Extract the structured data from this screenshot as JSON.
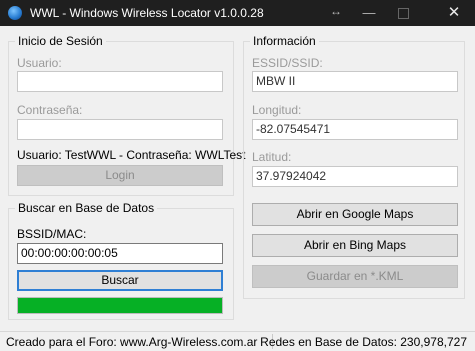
{
  "window": {
    "title": "WWL - Windows Wireless Locator v1.0.0.28",
    "close_glyph": "✕",
    "minimize_glyph": "—"
  },
  "login_group": {
    "title": "Inicio de Sesión",
    "user_label": "Usuario:",
    "user_value": "",
    "password_label": "Contraseña:",
    "password_value": "",
    "hint": "Usuario: TestWWL - Contraseña: WWLTest",
    "login_button": "Login"
  },
  "search_group": {
    "title": "Buscar en Base de Datos",
    "bssid_label": "BSSID/MAC:",
    "bssid_value": "00:00:00:00:00:05",
    "search_button": "Buscar",
    "progress_percent": 100
  },
  "info_group": {
    "title": "Información",
    "essid_label": "ESSID/SSID:",
    "essid_value": "MBW II",
    "longitude_label": "Longitud:",
    "longitude_value": "-82.07545471",
    "latitude_label": "Latitud:",
    "latitude_value": "37.97924042",
    "google_button": "Abrir en Google Maps",
    "bing_button": "Abrir en Bing Maps",
    "kml_button": "Guardar en *.KML"
  },
  "status": {
    "left": "Creado para el Foro: www.Arg-Wireless.com.ar",
    "right": "Redes en Base de Datos: 230,978,727"
  },
  "colors": {
    "titlebar": "#1f1f1f",
    "progress": "#06b025",
    "focus": "#2f7fd4"
  },
  "icons": [
    "globe-icon",
    "resize-icon",
    "minimize-icon",
    "maximize-icon",
    "close-icon"
  ]
}
